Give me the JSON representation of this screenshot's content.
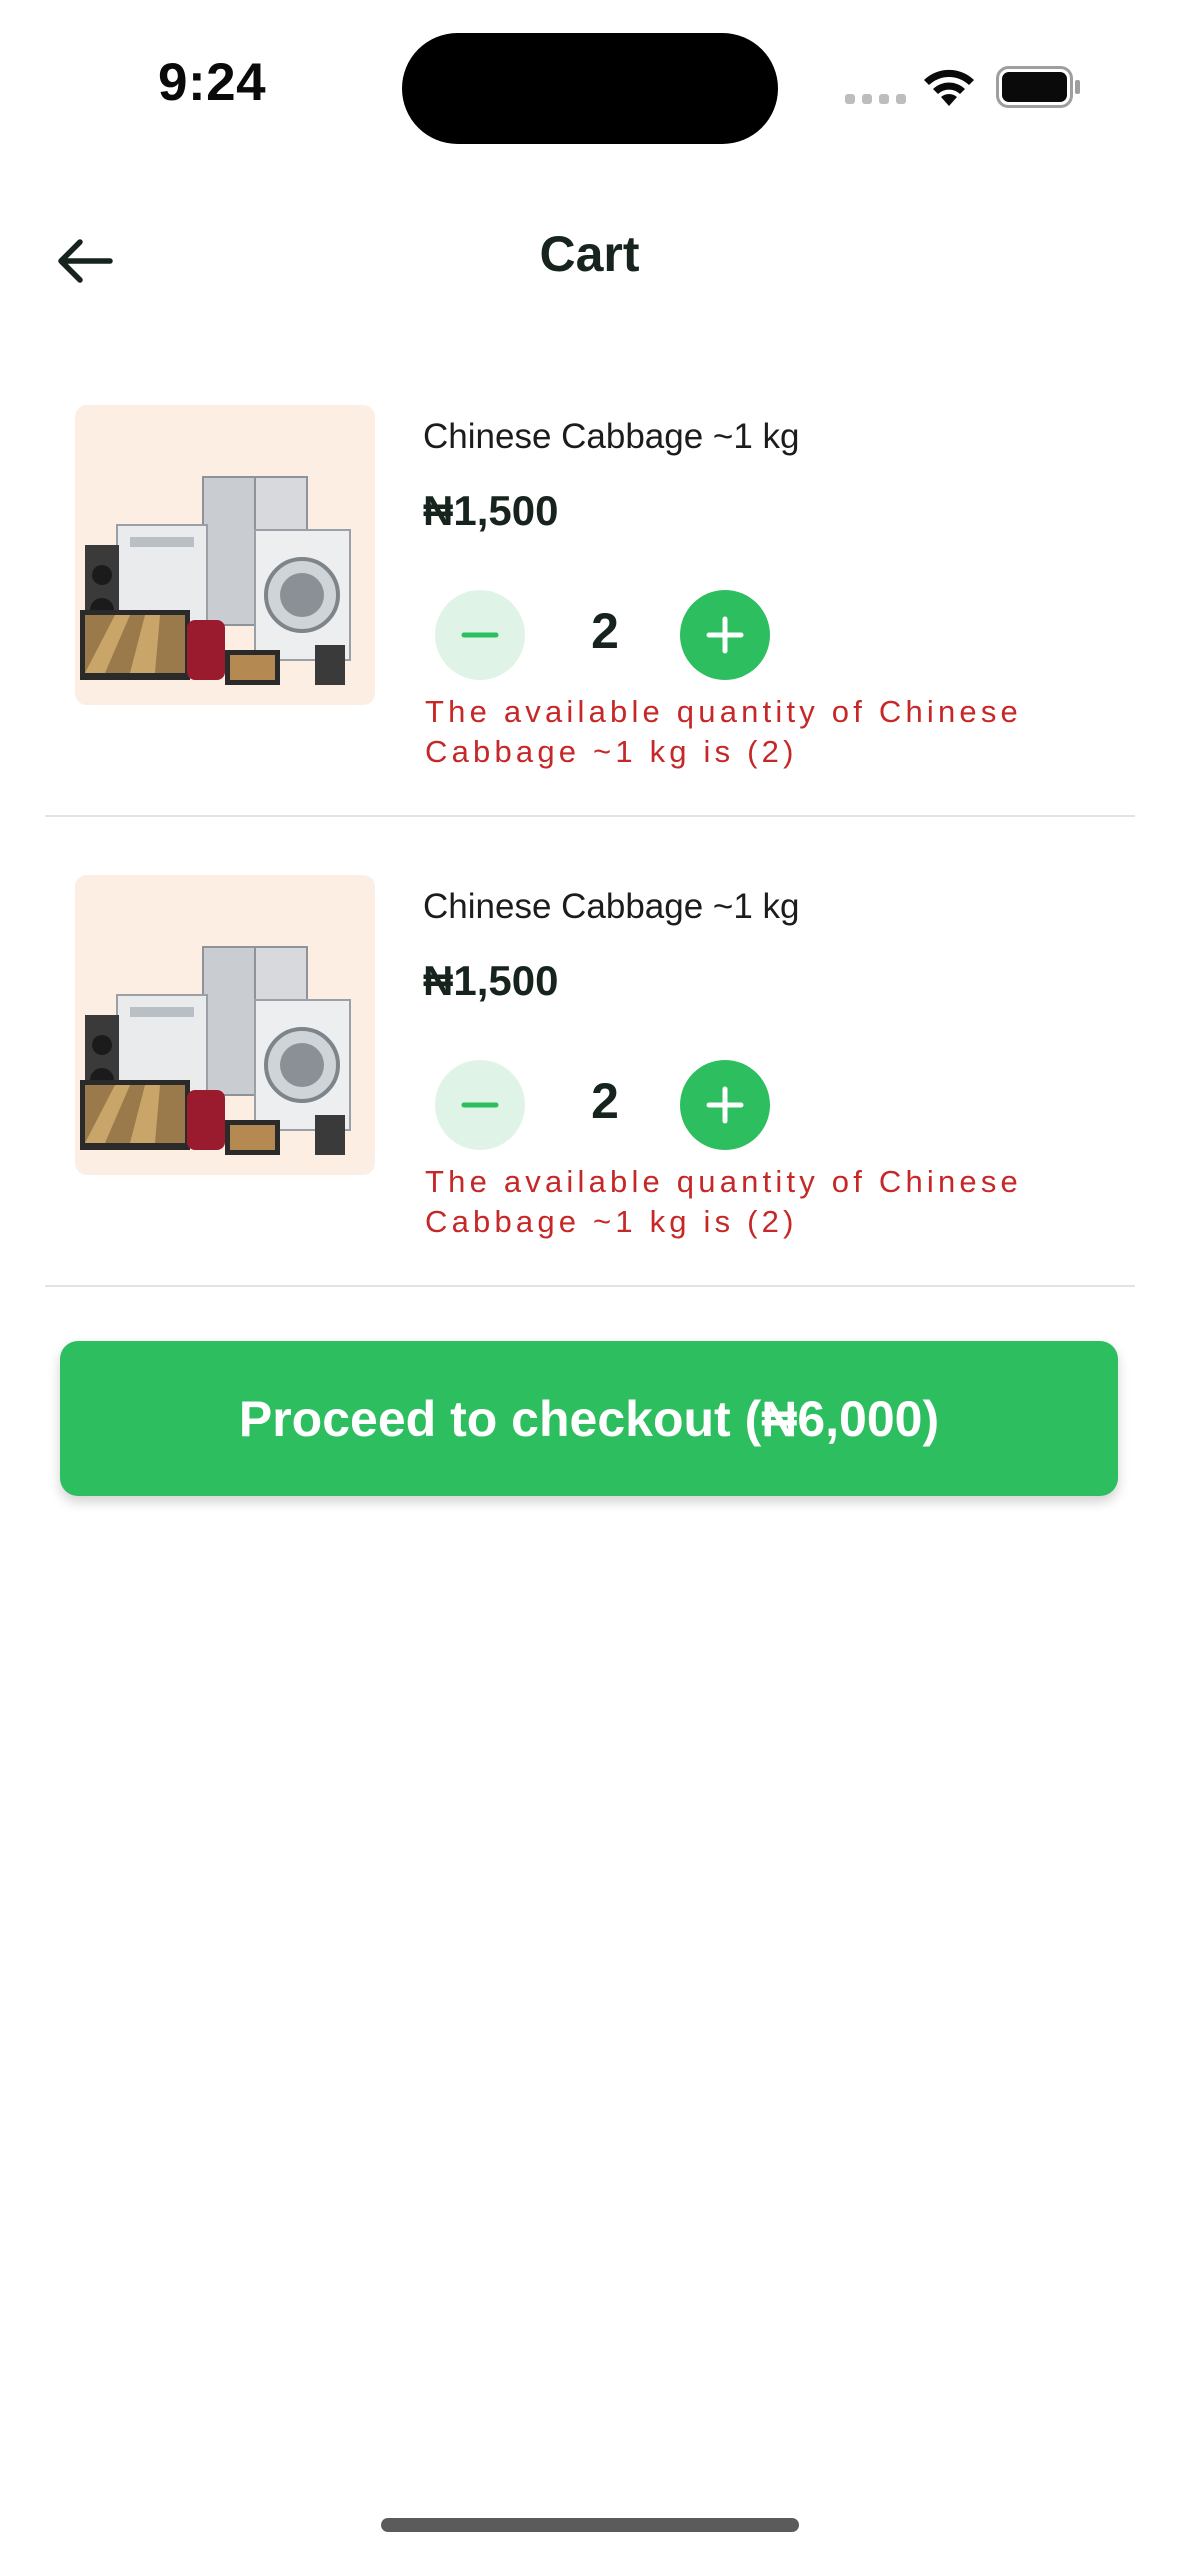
{
  "status_bar": {
    "time": "9:24"
  },
  "header": {
    "title": "Cart"
  },
  "cart_items": [
    {
      "name": "Chinese Cabbage ~1 kg",
      "price": "₦1,500",
      "quantity": "2",
      "warning": "The available quantity of Chinese Cabbage ~1 kg is (2)",
      "image_icon": "home-appliances-photo"
    },
    {
      "name": "Chinese Cabbage ~1 kg",
      "price": "₦1,500",
      "quantity": "2",
      "warning": "The available quantity of Chinese Cabbage ~1 kg is (2)",
      "image_icon": "home-appliances-photo"
    }
  ],
  "checkout": {
    "label": "Proceed to checkout (₦6,000)"
  },
  "colors": {
    "accent": "#2dbe5f",
    "accent_light": "#dff4e7",
    "warning": "#c62828",
    "thumb_bg": "#fdeee3"
  }
}
